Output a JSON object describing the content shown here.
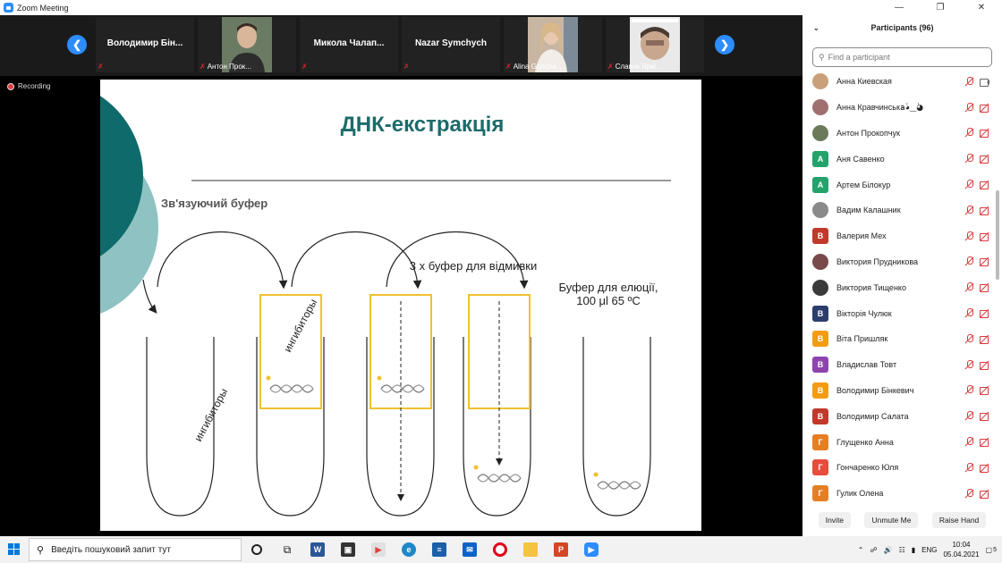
{
  "window": {
    "title": "Zoom Meeting",
    "minimize": "—",
    "restore": "❐",
    "close": "✕"
  },
  "strip": {
    "tiles": [
      {
        "name": "Володимир  Бін...",
        "footer": ""
      },
      {
        "name": "",
        "footer": "Антон Прок..."
      },
      {
        "name": "Микола  Чалап...",
        "footer": ""
      },
      {
        "name": "Nazar Symchych",
        "footer": ""
      },
      {
        "name": "",
        "footer": "Alina Goncha..."
      },
      {
        "name": "",
        "footer": "Славик Ярм..."
      }
    ]
  },
  "recording": "Recording",
  "slide": {
    "title": "ДНК-екстракція",
    "binding_buffer": "Зв'язуючий буфер",
    "wash_buffer": "3 х буфер для відмивки",
    "elution_line1": "Буфер для елюції,",
    "elution_line2": "100 μl  65 ºC",
    "inhibitors": "ингибиторы"
  },
  "panel": {
    "title": "Participants (96)",
    "search_placeholder": "Find a participant",
    "participants": [
      {
        "name": "Анна Киевская",
        "initial": "",
        "color": "#c9a07a",
        "photo": true,
        "cam": "on"
      },
      {
        "name": "Анна Кравчинськаٰ◕‿◕ٰ",
        "initial": "",
        "color": "#a07070",
        "photo": true,
        "cam": "off"
      },
      {
        "name": "Антон Прокопчук",
        "initial": "",
        "color": "#6a7a5a",
        "photo": true,
        "cam": "off"
      },
      {
        "name": "Аня Савенко",
        "initial": "А",
        "color": "#23a36b",
        "photo": false,
        "cam": "off"
      },
      {
        "name": "Артем Білокур",
        "initial": "А",
        "color": "#23a36b",
        "photo": false,
        "cam": "off"
      },
      {
        "name": "Вадим Калашник",
        "initial": "",
        "color": "#8a8a8a",
        "photo": true,
        "cam": "off"
      },
      {
        "name": "Валерия Мех",
        "initial": "В",
        "color": "#c0392b",
        "photo": false,
        "cam": "off"
      },
      {
        "name": "Виктория Прудникова",
        "initial": "",
        "color": "#7a4a4a",
        "photo": true,
        "cam": "off"
      },
      {
        "name": "Виктория Тищенко",
        "initial": "",
        "color": "#3a3a3a",
        "photo": true,
        "cam": "off"
      },
      {
        "name": "Вікторія Чулюк",
        "initial": "В",
        "color": "#2c3e6b",
        "photo": false,
        "cam": "off"
      },
      {
        "name": "Віта Пришляк",
        "initial": "В",
        "color": "#f39c12",
        "photo": false,
        "cam": "off"
      },
      {
        "name": "Владислав Товт",
        "initial": "В",
        "color": "#8e44ad",
        "photo": false,
        "cam": "off"
      },
      {
        "name": "Володимир Бінкевич",
        "initial": "В",
        "color": "#f39c12",
        "photo": false,
        "cam": "off"
      },
      {
        "name": "Володимир Салата",
        "initial": "В",
        "color": "#c0392b",
        "photo": false,
        "cam": "off"
      },
      {
        "name": "Глущенко Анна",
        "initial": "Г",
        "color": "#e67e22",
        "photo": false,
        "cam": "off"
      },
      {
        "name": "Гончаренко Юля",
        "initial": "Г",
        "color": "#e74c3c",
        "photo": false,
        "cam": "off"
      },
      {
        "name": "Гулик Олена",
        "initial": "Г",
        "color": "#e67e22",
        "photo": false,
        "cam": "off"
      }
    ],
    "invite": "Invite",
    "unmute_me": "Unmute Me",
    "raise_hand": "Raise Hand"
  },
  "taskbar": {
    "search_placeholder": "Введіть пошуковий запит тут",
    "lang": "ENG",
    "time": "10:04",
    "date": "05.04.2021",
    "notifications": "5"
  }
}
